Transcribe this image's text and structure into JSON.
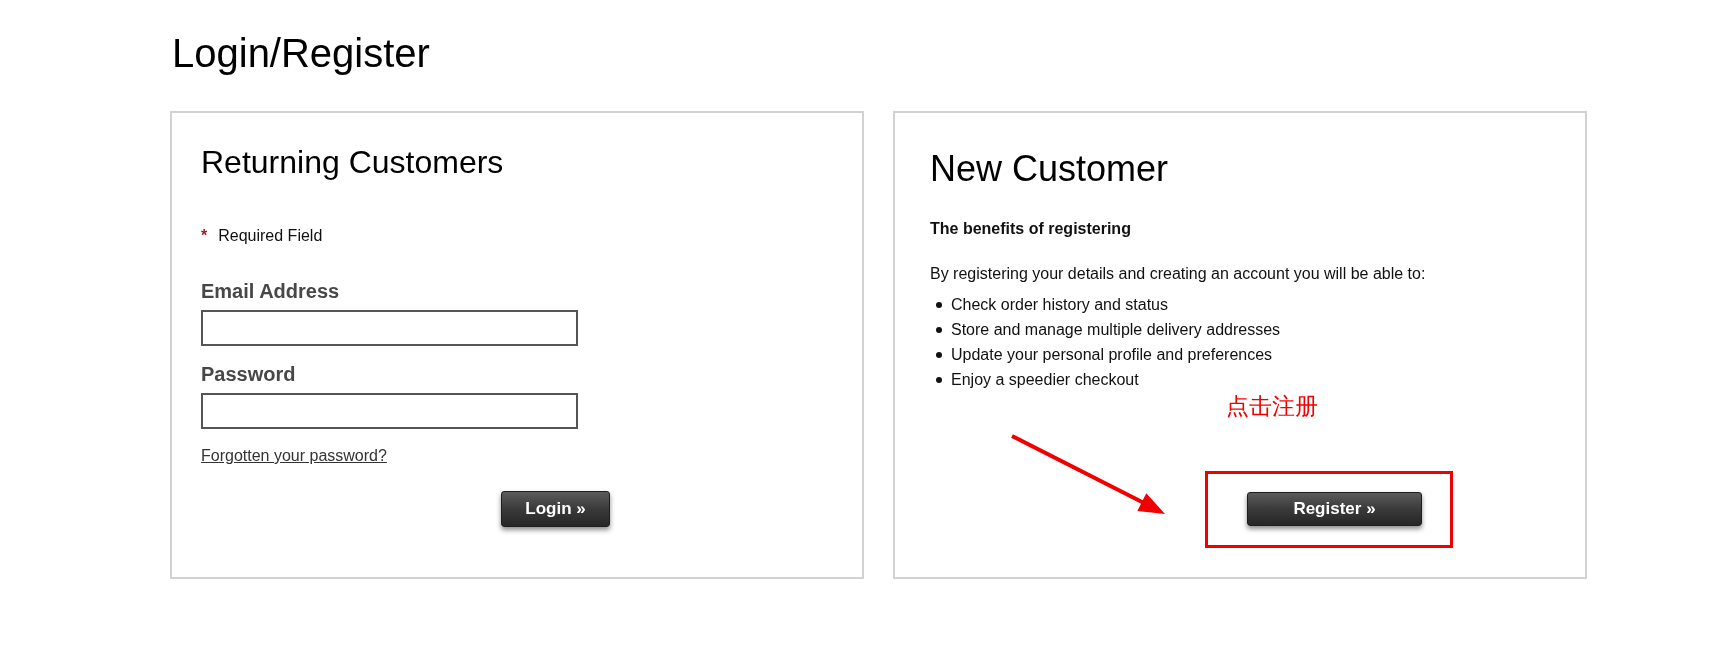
{
  "page": {
    "title": "Login/Register"
  },
  "returning_customers": {
    "heading": "Returning Customers",
    "required_note": {
      "marker": "*",
      "text": "Required Field"
    },
    "fields": [
      {
        "label": "Email Address"
      },
      {
        "label": "Password"
      }
    ],
    "forgot_link": "Forgotten your password?",
    "login_button": "Login »"
  },
  "new_customer": {
    "heading": "New Customer",
    "subheading": "The benefits of registering",
    "intro": "By registering your details and creating an account you will be able to:",
    "benefits": [
      "Check order history and status",
      "Store and manage multiple delivery addresses",
      "Update your personal profile and preferences",
      "Enjoy a speedier checkout"
    ],
    "register_button": "Register »"
  },
  "annotation": {
    "text": "点击注册"
  }
}
